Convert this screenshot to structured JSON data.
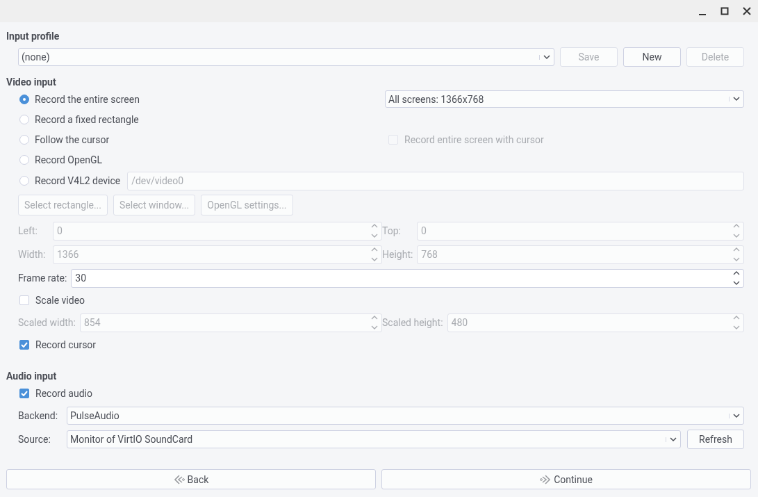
{
  "input_profile": {
    "title": "Input profile",
    "profile": "(none)",
    "buttons": [
      {
        "label": "Save",
        "disabled": true
      },
      {
        "label": "New",
        "disabled": false
      },
      {
        "label": "Delete",
        "disabled": true
      }
    ]
  },
  "video_input": {
    "title": "Video input",
    "modes": [
      {
        "label": "Record the entire screen",
        "selected": true
      },
      {
        "label": "Record a fixed rectangle",
        "selected": false
      },
      {
        "label": "Follow the cursor",
        "selected": false
      },
      {
        "label": "Record OpenGL",
        "selected": false
      },
      {
        "label": "Record V4L2 device",
        "selected": false
      }
    ],
    "screen": "All screens: 1366x768",
    "cursor_option": {
      "label": "Record entire screen with cursor",
      "checked": false,
      "disabled": true
    },
    "device": {
      "value": "/dev/video0",
      "disabled": true
    },
    "buttons": [
      {
        "label": "Select rectangle...",
        "disabled": true
      },
      {
        "label": "Select window...",
        "disabled": true
      },
      {
        "label": "OpenGL settings...",
        "disabled": true
      }
    ],
    "geometry": [
      [
        {
          "label": "Left:",
          "value": "0",
          "disabled": true
        },
        {
          "label": "Top:",
          "value": "0",
          "disabled": true
        }
      ],
      [
        {
          "label": "Width:",
          "value": "1366",
          "disabled": true
        },
        {
          "label": "Height:",
          "value": "768",
          "disabled": true
        }
      ]
    ],
    "frame_rate": {
      "label": "Frame rate:",
      "value": "30",
      "disabled": false
    },
    "scale_video": {
      "label": "Scale video",
      "checked": false
    },
    "scaled": [
      {
        "label": "Scaled width:",
        "value": "854",
        "disabled": true
      },
      {
        "label": "Scaled height:",
        "value": "480",
        "disabled": true
      }
    ],
    "record_cursor": {
      "label": "Record cursor",
      "checked": true
    }
  },
  "audio_input": {
    "title": "Audio input",
    "record_audio": {
      "label": "Record audio",
      "checked": true
    },
    "backend": {
      "label": "Backend:",
      "value": "PulseAudio"
    },
    "source": {
      "label": "Source:",
      "value": "Monitor of VirtIO SoundCard"
    },
    "refresh": "Refresh"
  },
  "footer": {
    "buttons": [
      {
        "label": "Back",
        "kind": "back"
      },
      {
        "label": "Continue",
        "kind": "forward"
      }
    ]
  }
}
